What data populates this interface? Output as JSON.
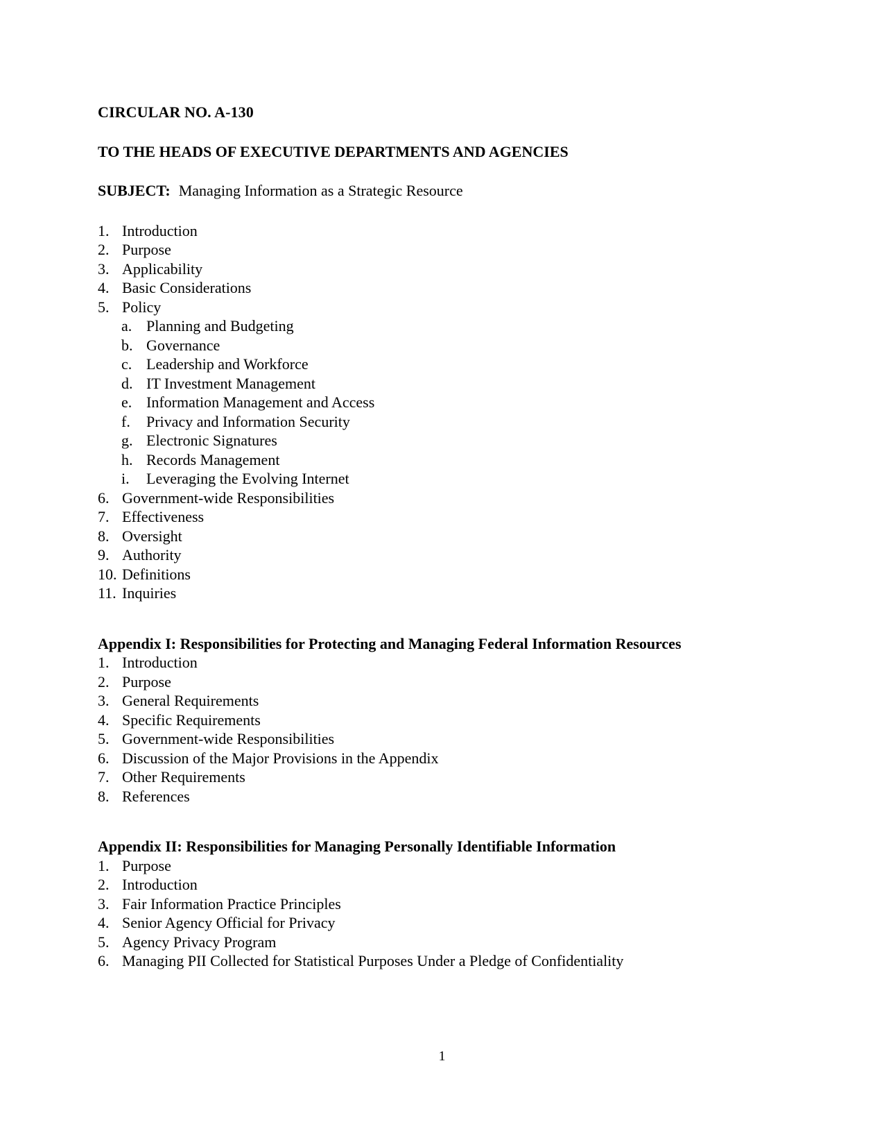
{
  "document": {
    "circular_number": "CIRCULAR NO. A-130",
    "addressee": "TO THE HEADS OF EXECUTIVE DEPARTMENTS AND AGENCIES",
    "subject_label": "SUBJECT:",
    "subject_value": "Managing Information as a Strategic Resource",
    "page_number": "1",
    "text_color": "#000000",
    "background_color": "#ffffff"
  },
  "main_toc": {
    "items": [
      {
        "marker": "1.",
        "label": "Introduction"
      },
      {
        "marker": "2.",
        "label": "Purpose"
      },
      {
        "marker": "3.",
        "label": "Applicability"
      },
      {
        "marker": "4.",
        "label": "Basic Considerations"
      },
      {
        "marker": "5.",
        "label": "Policy"
      },
      {
        "marker": "6.",
        "label": "Government-wide Responsibilities"
      },
      {
        "marker": "7.",
        "label": "Effectiveness"
      },
      {
        "marker": "8.",
        "label": "Oversight"
      },
      {
        "marker": "9.",
        "label": "Authority"
      },
      {
        "marker": "10.",
        "label": "Definitions"
      },
      {
        "marker": "11.",
        "label": "Inquiries"
      }
    ],
    "policy_subitems": [
      {
        "marker": "a.",
        "label": "Planning and Budgeting"
      },
      {
        "marker": "b.",
        "label": "Governance"
      },
      {
        "marker": "c.",
        "label": "Leadership and Workforce"
      },
      {
        "marker": "d.",
        "label": "IT Investment Management"
      },
      {
        "marker": "e.",
        "label": "Information Management and Access"
      },
      {
        "marker": "f.",
        "label": "Privacy and Information Security"
      },
      {
        "marker": "g.",
        "label": "Electronic Signatures"
      },
      {
        "marker": "h.",
        "label": "Records Management"
      },
      {
        "marker": "i.",
        "label": "Leveraging the Evolving Internet"
      }
    ]
  },
  "appendix_i": {
    "heading": "Appendix I: Responsibilities for Protecting and Managing Federal Information Resources",
    "items": [
      {
        "marker": "1.",
        "label": "Introduction"
      },
      {
        "marker": "2.",
        "label": "Purpose"
      },
      {
        "marker": "3.",
        "label": "General Requirements"
      },
      {
        "marker": "4.",
        "label": "Specific Requirements"
      },
      {
        "marker": "5.",
        "label": "Government-wide Responsibilities"
      },
      {
        "marker": "6.",
        "label": "Discussion of the Major Provisions in the Appendix"
      },
      {
        "marker": "7.",
        "label": "Other Requirements"
      },
      {
        "marker": "8.",
        "label": "References"
      }
    ]
  },
  "appendix_ii": {
    "heading": "Appendix II: Responsibilities for Managing Personally Identifiable Information",
    "items": [
      {
        "marker": "1.",
        "label": "Purpose"
      },
      {
        "marker": "2.",
        "label": "Introduction"
      },
      {
        "marker": "3.",
        "label": "Fair Information Practice Principles"
      },
      {
        "marker": "4.",
        "label": "Senior Agency Official for Privacy"
      },
      {
        "marker": "5.",
        "label": "Agency Privacy Program"
      },
      {
        "marker": "6.",
        "label": "Managing PII Collected for Statistical Purposes Under a Pledge of Confidentiality"
      }
    ]
  }
}
